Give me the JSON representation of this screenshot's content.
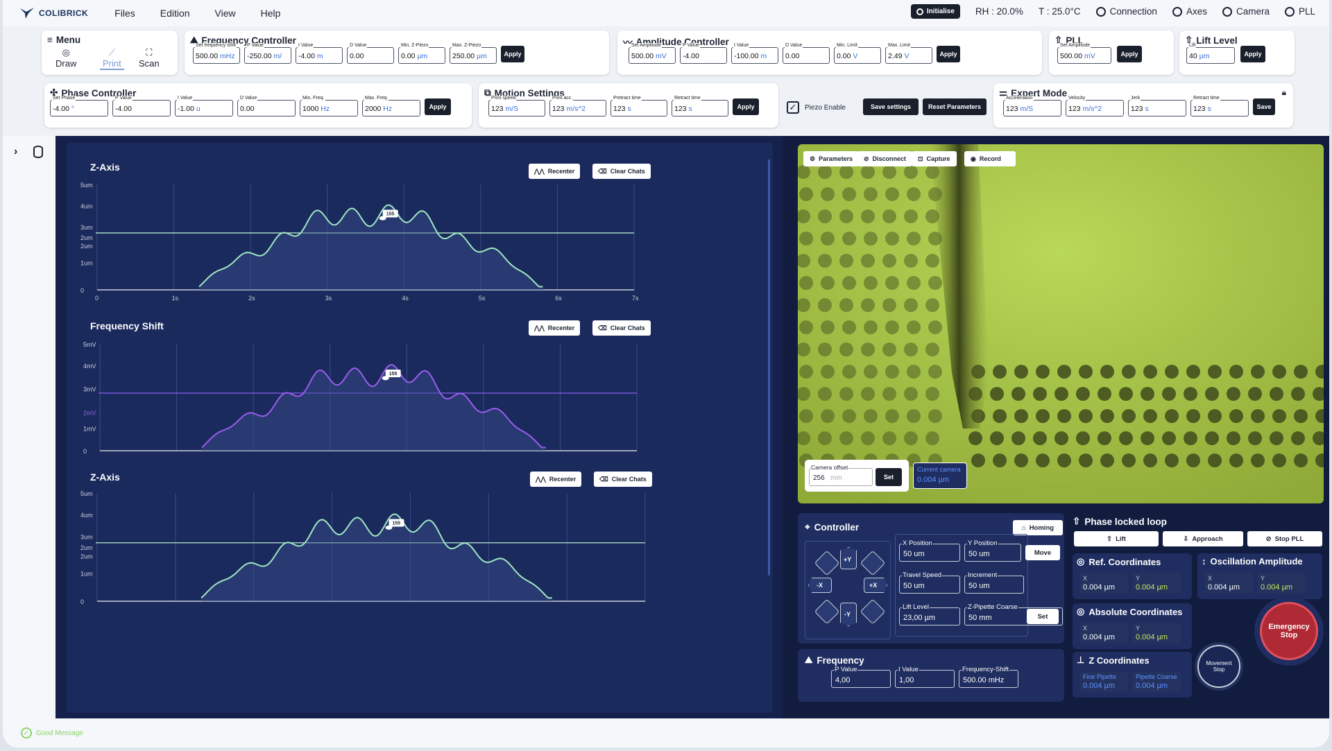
{
  "app": {
    "brand": "COLIBRICK",
    "menu": [
      "Files",
      "Edition",
      "View",
      "Help"
    ]
  },
  "status": {
    "initialise": "Initialise",
    "rh": "RH : 20.0%",
    "t": "T : 25.0°C",
    "connection": "Connection",
    "axes": "Axes",
    "camera": "Camera",
    "pll": "PLL"
  },
  "menu_panel": {
    "title": "Menu",
    "draw": "Draw",
    "print": "Print",
    "scan": "Scan"
  },
  "freq_ctrl": {
    "title": "Frequency Controller",
    "fields": [
      {
        "label": "Set frequency shift",
        "value": "500.00",
        "unit": "mHz"
      },
      {
        "label": "P Value",
        "value": "-250.00",
        "unit": "m/"
      },
      {
        "label": "I Value",
        "value": "-4.00",
        "unit": "m"
      },
      {
        "label": "D Value",
        "value": "0.00",
        "unit": ""
      },
      {
        "label": "Min. Z-Piezo",
        "value": "0.00",
        "unit": "µm"
      },
      {
        "label": "Max. Z-Piezo",
        "value": "250.00",
        "unit": "µm"
      }
    ],
    "apply": "Apply"
  },
  "amp_ctrl": {
    "title": "Amplitude Controller",
    "fields": [
      {
        "label": "Set Amplitude",
        "value": "500.00",
        "unit": "mV"
      },
      {
        "label": "P Value",
        "value": "-4.00",
        "unit": ""
      },
      {
        "label": "I Value",
        "value": "-100.00",
        "unit": "m"
      },
      {
        "label": "D Value",
        "value": "0.00",
        "unit": ""
      },
      {
        "label": "Min. Limit",
        "value": "0.00",
        "unit": "V"
      },
      {
        "label": "Max. Limit",
        "value": "2.49",
        "unit": "V"
      }
    ],
    "apply": "Apply"
  },
  "pll_panel": {
    "title": "PLL",
    "fields": [
      {
        "label": "Set Amplitude",
        "value": "500.00",
        "unit": "mV"
      }
    ],
    "apply": "Apply"
  },
  "lift_panel": {
    "title": "Lift Level",
    "fields": [
      {
        "label": "Lift",
        "value": "40",
        "unit": "µm"
      }
    ],
    "apply": "Apply"
  },
  "phase_ctrl": {
    "title": "Phase Controller",
    "fields": [
      {
        "label": "Set Phase",
        "value": "-4.00",
        "unit": "°"
      },
      {
        "label": "P Value",
        "value": "-4.00",
        "unit": ""
      },
      {
        "label": "I Value",
        "value": "-1.00",
        "unit": "u"
      },
      {
        "label": "D Value",
        "value": "0.00",
        "unit": ""
      },
      {
        "label": "Min. Freq.",
        "value": "1000",
        "unit": "Hz"
      },
      {
        "label": "Max. Freq.",
        "value": "2000",
        "unit": "Hz"
      }
    ],
    "apply": "Apply"
  },
  "motion": {
    "title": "Motion Settings",
    "fields": [
      {
        "label": "Print speed",
        "value": "123",
        "unit": "m/S"
      },
      {
        "label": "Print acc.",
        "value": "123",
        "unit": "m/s^2"
      },
      {
        "label": "Pretract time",
        "value": "123",
        "unit": "s"
      },
      {
        "label": "Retract time",
        "value": "123",
        "unit": "s"
      }
    ],
    "apply": "Apply"
  },
  "piezo": {
    "label": "Piezo Enable",
    "save": "Save settings",
    "reset": "Reset Parameters"
  },
  "expert": {
    "title": "Expert Mode",
    "fields": [
      {
        "label": "Acceleration",
        "value": "123",
        "unit": "m/S"
      },
      {
        "label": "Velocity",
        "value": "123",
        "unit": "m/s^2"
      },
      {
        "label": "Jerk",
        "value": "123",
        "unit": "s"
      },
      {
        "label": "Retract time",
        "value": "123",
        "unit": "s"
      }
    ],
    "save": "Save"
  },
  "chart_buttons": {
    "recenter": "Recenter",
    "clear": "Clear Chats"
  },
  "chart_data": [
    {
      "type": "line",
      "title": "Z-Axis",
      "ylabels": [
        "5um",
        "4um",
        "3um",
        "2um",
        "2um",
        "1um",
        "0"
      ],
      "xlabels": [
        "0",
        "1s",
        "2s",
        "3s",
        "4s",
        "5s",
        "6s",
        "7s"
      ],
      "marker": "155",
      "color": "#9fe7c4"
    },
    {
      "type": "line",
      "title": "Frequency Shift",
      "ylabels": [
        "5mV",
        "4mV",
        "3mV",
        "2mV",
        "1mV",
        "0"
      ],
      "marker": "155",
      "color": "#9b5cf0"
    },
    {
      "type": "line",
      "title": "Z-Axis",
      "ylabels": [
        "5um",
        "4um",
        "3um",
        "2um",
        "2um",
        "1um",
        "0"
      ],
      "marker": "155",
      "color": "#9fe7c4"
    }
  ],
  "camera": {
    "tools": [
      "Parameters",
      "Disconnect",
      "Capture",
      "Record"
    ],
    "offset_label": "Camera offset",
    "offset_value": "256",
    "offset_unit": "mm",
    "set": "Set",
    "current_label": "Current camera",
    "current_value": "0.004 µm"
  },
  "controller": {
    "title": "Controller",
    "homing": "Homing",
    "xpos_l": "X Position",
    "xpos": "50 um",
    "ypos_l": "Y Position",
    "ypos": "50 um",
    "move": "Move",
    "speed_l": "Travel Speed",
    "speed": "50 um",
    "inc_l": "Increment",
    "inc": "50 um",
    "lift_l": "Lift Level",
    "lift": "23,00 µm",
    "zp_l": "Z-Pipette Coarse",
    "zp": "50 mm",
    "set": "Set",
    "jog": [
      "+Y",
      "-X",
      "+X",
      "-Y"
    ]
  },
  "frequency": {
    "title": "Frequency",
    "p_l": "P Value",
    "p": "4,00",
    "i_l": "I Value",
    "i": "1,00",
    "fs_l": "Frequency-Shift",
    "fs": "500.00 mHz"
  },
  "pll_ctrl": {
    "title": "Phase locked loop",
    "lift": "Lift",
    "approach": "Approach",
    "stop": "Stop PLL"
  },
  "ref": {
    "title": "Ref. Coordinates",
    "x_l": "X",
    "x": "0.004 µm",
    "y_l": "Y",
    "y": "0.004 µm"
  },
  "osc": {
    "title": "Oscillation Amplitude",
    "x_l": "X",
    "x": "0.004 µm",
    "y_l": "Y",
    "y": "0.004 µm"
  },
  "abs": {
    "title": "Absolute Coordinates",
    "x_l": "X",
    "x": "0.004 µm",
    "y_l": "Y",
    "y": "0.004 µm"
  },
  "zc": {
    "title": "Z Coordinates",
    "fine_l": "Fine Pipette",
    "fine": "0.004 µm",
    "coarse_l": "Pipette Coarse",
    "coarse": "0.004 µm"
  },
  "emergency": {
    "line1": "Emergency",
    "line2": "Stop",
    "mv1": "Movement",
    "mv2": "Stop"
  },
  "footer": {
    "message": "Good Message"
  }
}
